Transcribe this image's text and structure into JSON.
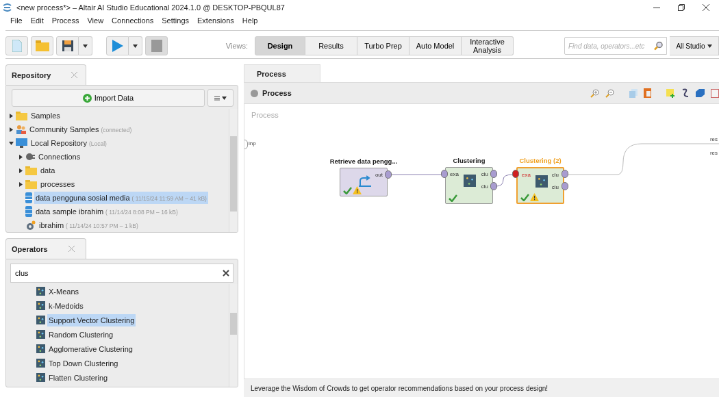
{
  "window": {
    "title": "<new process*> – Altair AI Studio Educational 2024.1.0 @ DESKTOP-PBQUL87"
  },
  "menu": [
    "File",
    "Edit",
    "Process",
    "View",
    "Connections",
    "Settings",
    "Extensions",
    "Help"
  ],
  "toolbar": {
    "views_label": "Views:",
    "views": [
      {
        "label": "Design",
        "selected": true
      },
      {
        "label": "Results",
        "selected": false
      },
      {
        "label": "Turbo Prep",
        "selected": false
      },
      {
        "label": "Auto Model",
        "selected": false
      },
      {
        "label": "Interactive Analysis",
        "selected": false
      }
    ],
    "search": {
      "placeholder": "Find data, operators...etc"
    },
    "scope": "All Studio"
  },
  "repository": {
    "tab": "Repository",
    "import_button": "Import Data",
    "tree": [
      {
        "kind": "folder",
        "label": "Samples",
        "expanded": false,
        "selected": false
      },
      {
        "kind": "community",
        "label": "Community Samples",
        "meta": "(connected)",
        "expanded": false,
        "selected": false
      },
      {
        "kind": "local",
        "label": "Local Repository",
        "meta": "(Local)",
        "expanded": true,
        "selected": false,
        "children": [
          {
            "kind": "connections",
            "label": "Connections",
            "expanded": false,
            "selected": false
          },
          {
            "kind": "folder",
            "label": "data",
            "expanded": false,
            "selected": false
          },
          {
            "kind": "folder",
            "label": "processes",
            "expanded": false,
            "selected": false
          },
          {
            "kind": "data",
            "label": "data pengguna sosial media",
            "meta": "( 11/15/24 11:59 AM – 41 kB)",
            "selected": true
          },
          {
            "kind": "data",
            "label": "data sample ibrahim",
            "meta": "( 11/14/24 8:08 PM – 16 kB)",
            "selected": false
          },
          {
            "kind": "process",
            "label": "ibrahim",
            "meta": "( 11/14/24 10:57 PM – 1 kB)",
            "selected": false
          }
        ]
      }
    ]
  },
  "operators": {
    "tab": "Operators",
    "search": {
      "value": "clus"
    },
    "items": [
      {
        "label": "X-Means",
        "selected": false
      },
      {
        "label": "k-Medoids",
        "selected": false
      },
      {
        "label": "Support Vector Clustering",
        "selected": true
      },
      {
        "label": "Random Clustering",
        "selected": false
      },
      {
        "label": "Agglomerative Clustering",
        "selected": false
      },
      {
        "label": "Top Down Clustering",
        "selected": false
      },
      {
        "label": "Flatten Clustering",
        "selected": false
      }
    ]
  },
  "process": {
    "tab": "Process",
    "breadcrumb": "Process",
    "canvas_label": "Process",
    "input_port": "inp",
    "result_ports": [
      "res",
      "res"
    ],
    "nodes": [
      {
        "kind": "retrieve",
        "title": "Retrieve data pengg...",
        "selected": false,
        "out_ports": [
          "out"
        ],
        "ok": true,
        "warning": true
      },
      {
        "kind": "clustering",
        "title": "Clustering",
        "selected": false,
        "in_ports": [
          {
            "label": "exa",
            "error": false
          }
        ],
        "out_ports": [
          "clu",
          "clu"
        ],
        "ok": true,
        "warning": false
      },
      {
        "kind": "clustering",
        "title": "Clustering (2)",
        "selected": true,
        "in_ports": [
          {
            "label": "exa",
            "error": true
          }
        ],
        "out_ports": [
          "clu",
          "clu"
        ],
        "ok": true,
        "warning": true
      }
    ],
    "footer": "Leverage the Wisdom of Crowds to get operator recommendations based on your process design!"
  }
}
